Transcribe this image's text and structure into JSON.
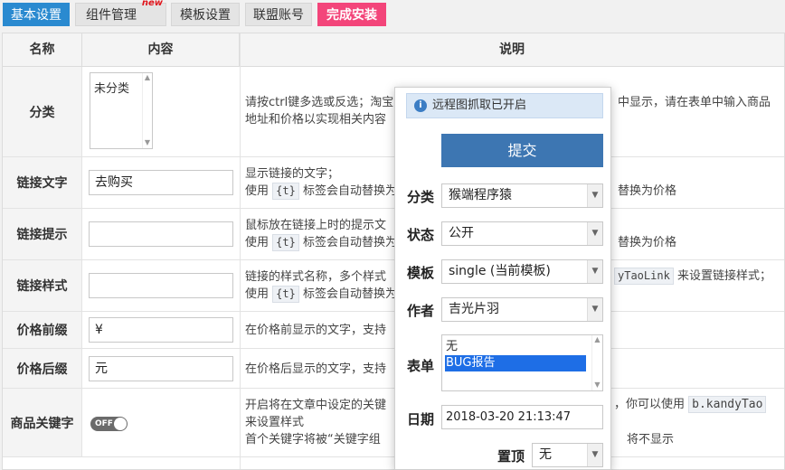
{
  "tabs": [
    {
      "label": "基本设置"
    },
    {
      "label": "组件管理",
      "badge": "new"
    },
    {
      "label": "模板设置"
    },
    {
      "label": "联盟账号"
    },
    {
      "label": "完成安装"
    }
  ],
  "table": {
    "headers": [
      "名称",
      "内容",
      "说明"
    ],
    "rows": {
      "category": {
        "label": "分类",
        "list_option": "未分类",
        "desc_left": "请按ctrl键多选或反选；淘宝",
        "desc_right": "中显示，请在表单中输入商品",
        "desc_line2": "地址和价格以实现相关内容"
      },
      "link_text": {
        "label": "链接文字",
        "value": "去购买",
        "desc_line1": "显示链接的文字；",
        "desc_use": "使用",
        "desc_tag": "{t}",
        "desc_mid": "标签会自动替换为",
        "desc_right": "替换为价格"
      },
      "link_tip": {
        "label": "链接提示",
        "value": "",
        "desc_line1": "鼠标放在链接上时的提示文",
        "desc_use": "使用",
        "desc_tag": "{t}",
        "desc_mid": "标签会自动替换为",
        "desc_right": "替换为价格"
      },
      "link_style": {
        "label": "链接样式",
        "value": "",
        "desc_line1": "链接的样式名称，多个样式",
        "desc_code": "yTaoLink",
        "desc_right": "来设置链接样式；",
        "desc_use": "使用",
        "desc_tag": "{t}",
        "desc_mid": "标签会自动替换为"
      },
      "price_prefix": {
        "label": "价格前缀",
        "value": "¥",
        "desc": "在价格前显示的文字，支持"
      },
      "price_suffix": {
        "label": "价格后缀",
        "value": "元",
        "desc": "在价格后显示的文字，支持"
      },
      "keyword": {
        "label": "商品关键字",
        "toggle": "OFF",
        "desc_line1": "开启将在文章中设定的关键",
        "desc_right1": "，你可以使用",
        "desc_code": "b.kandyTao",
        "desc_line2": "来设置样式",
        "desc_line3": "首个关键字将被“关键字组",
        "desc_right3": "将不显示"
      }
    }
  },
  "popup": {
    "notice": "远程图抓取已开启",
    "submit": "提交",
    "fields": {
      "category": {
        "label": "分类",
        "value": "猴端程序猿"
      },
      "status": {
        "label": "状态",
        "value": "公开"
      },
      "template": {
        "label": "模板",
        "value": "single (当前模板)"
      },
      "author": {
        "label": "作者",
        "value": "吉光片羽"
      },
      "form": {
        "label": "表单",
        "options": [
          "无",
          "BUG报告"
        ]
      },
      "date": {
        "label": "日期",
        "value": "2018-03-20 21:13:47"
      },
      "sticky": {
        "label": "置顶",
        "value": "无"
      }
    }
  }
}
